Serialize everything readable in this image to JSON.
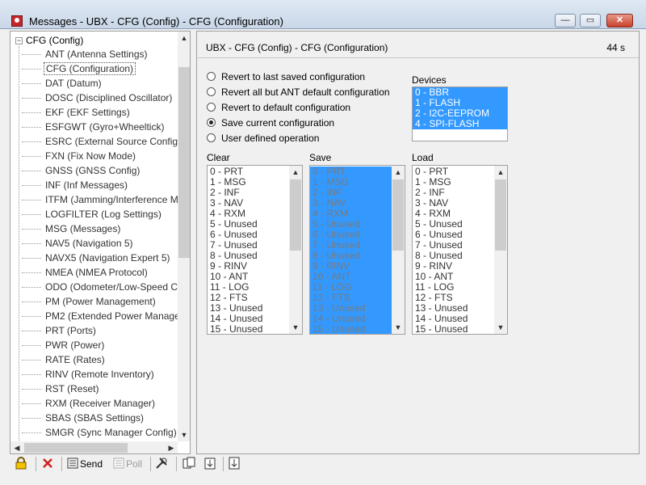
{
  "window": {
    "title": "Messages - UBX - CFG (Config) - CFG (Configuration)",
    "min_symbol": "—",
    "max_symbol": "▭",
    "close_symbol": "✕"
  },
  "tree": {
    "root": "CFG (Config)",
    "expander_symbol": "−",
    "selected": "CFG (Configuration)",
    "items": [
      "ANT (Antenna Settings)",
      "CFG (Configuration)",
      "DAT (Datum)",
      "DOSC (Disciplined Oscillator)",
      "EKF (EKF Settings)",
      "ESFGWT (Gyro+Wheeltick)",
      "ESRC (External Source Config)",
      "FXN (Fix Now Mode)",
      "GNSS (GNSS Config)",
      "INF (Inf Messages)",
      "ITFM (Jamming/Interference M",
      "LOGFILTER (Log Settings)",
      "MSG (Messages)",
      "NAV5 (Navigation 5)",
      "NAVX5 (Navigation Expert 5)",
      "NMEA (NMEA Protocol)",
      "ODO (Odometer/Low-Speed C",
      "PM (Power Management)",
      "PM2 (Extended Power Manager",
      "PRT (Ports)",
      "PWR (Power)",
      "RATE (Rates)",
      "RINV (Remote Inventory)",
      "RST (Reset)",
      "RXM (Receiver Manager)",
      "SBAS (SBAS Settings)",
      "SMGR (Sync Manager Config)"
    ]
  },
  "main": {
    "title": "UBX - CFG (Config) - CFG (Configuration)",
    "timer": "44 s",
    "options": [
      {
        "label": "Revert to last saved configuration",
        "checked": false
      },
      {
        "label": "Revert all but ANT default configuration",
        "checked": false
      },
      {
        "label": "Revert to default configuration",
        "checked": false
      },
      {
        "label": "Save current configuration",
        "checked": true
      },
      {
        "label": "User defined operation",
        "checked": false
      }
    ],
    "devices_label": "Devices",
    "devices": [
      "0 - BBR",
      "1 - FLASH",
      "2 - I2C-EEPROM",
      "4 - SPI-FLASH"
    ],
    "clear_label": "Clear",
    "save_label": "Save",
    "load_label": "Load",
    "sections": [
      "0 - PRT",
      "1 - MSG",
      "2 - INF",
      "3 - NAV",
      "4 - RXM",
      "5 - Unused",
      "6 - Unused",
      "7 - Unused",
      "8 - Unused",
      "9 - RINV",
      "10 - ANT",
      "11 - LOG",
      "12 - FTS",
      "13 - Unused",
      "14 - Unused",
      "15 - Unused"
    ]
  },
  "toolbar": {
    "send_label": "Send",
    "poll_label": "Poll"
  },
  "colors": {
    "selection": "#3399ff",
    "close_button": "#c8402c",
    "panel_bg": "#f0f0f0"
  },
  "icons": [
    "app-icon",
    "lock-icon",
    "delete-icon",
    "send-icon",
    "poll-icon",
    "tools-icon",
    "copy-icon",
    "paste-icon",
    "export-icon"
  ]
}
